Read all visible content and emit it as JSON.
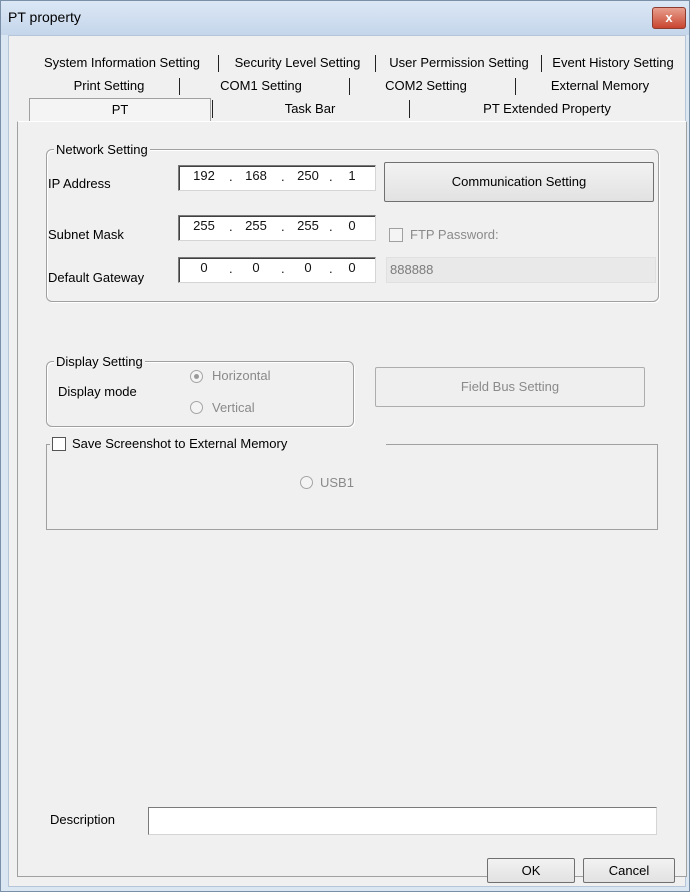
{
  "window": {
    "title": "PT property",
    "close_glyph": "x"
  },
  "tabs": {
    "row1": [
      "System Information Setting",
      "Security Level Setting",
      "User Permission Setting",
      "Event History Setting"
    ],
    "row2": [
      "Print Setting",
      "COM1 Setting",
      "COM2 Setting",
      "External Memory"
    ],
    "row3": [
      "PT",
      "Task Bar",
      "PT Extended Property"
    ]
  },
  "network": {
    "title": "Network Setting",
    "ip_label": "IP Address",
    "ip": [
      "192",
      "168",
      "250",
      "1"
    ],
    "subnet_label": "Subnet Mask",
    "subnet": [
      "255",
      "255",
      "255",
      "0"
    ],
    "gateway_label": "Default Gateway",
    "gateway": [
      "0",
      "0",
      "0",
      "0"
    ],
    "dot": ".",
    "comm_button": "Communication Setting",
    "ftp_label": "FTP Password:",
    "ftp_value": "888888"
  },
  "display": {
    "title": "Display Setting",
    "mode_label": "Display mode",
    "horizontal": "Horizontal",
    "vertical": "Vertical",
    "field_bus_button": "Field Bus Setting"
  },
  "screenshot": {
    "label": "Save Screenshot to External Memory",
    "usb": "USB1"
  },
  "description": {
    "label": "Description",
    "value": ""
  },
  "footer": {
    "ok": "OK",
    "cancel": "Cancel"
  }
}
